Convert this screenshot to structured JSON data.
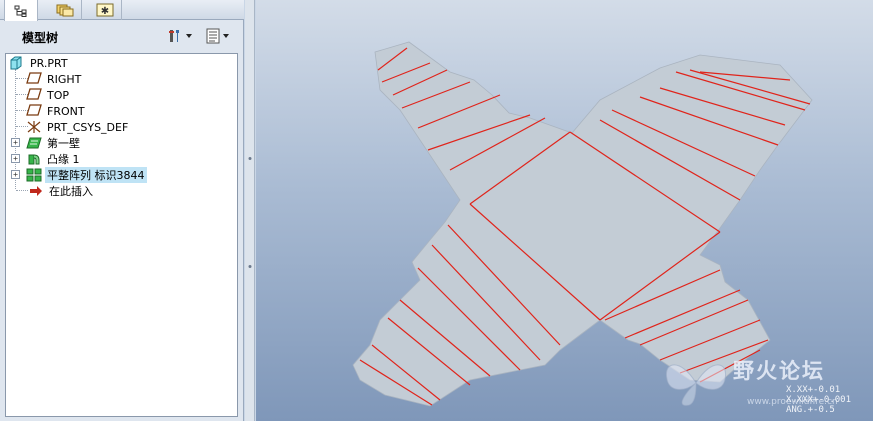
{
  "panel_tabs": [
    {
      "icon": "model-tree-icon",
      "active": true
    },
    {
      "icon": "folder-browser-icon",
      "active": false
    },
    {
      "icon": "favorites-icon",
      "active": false
    }
  ],
  "tree_header": {
    "title": "模型树",
    "settings_icon": "tools-icon",
    "show_icon": "list-icon"
  },
  "tree": {
    "items": [
      {
        "label": "PR.PRT",
        "icon": "part-icon"
      },
      {
        "label": "RIGHT",
        "icon": "datum-plane-icon"
      },
      {
        "label": "TOP",
        "icon": "datum-plane-icon"
      },
      {
        "label": "FRONT",
        "icon": "datum-plane-icon"
      },
      {
        "label": "PRT_CSYS_DEF",
        "icon": "csys-icon"
      },
      {
        "label": "第一壁",
        "icon": "first-wall-icon"
      },
      {
        "label": "凸缘 1",
        "icon": "flange-icon"
      },
      {
        "label": "平整阵列 标识3844",
        "icon": "pattern-icon"
      },
      {
        "label": "在此插入",
        "icon": "insert-here-arrow-icon"
      }
    ]
  },
  "viewport": {
    "tolerance_lines": [
      "X.XX+-0.01",
      "X.XXX+-0.001",
      "ANG.+-0.5"
    ],
    "watermark_text": "野火论坛",
    "watermark_url": "www.proewildfire.cn",
    "colors": {
      "sheet_fill": "#c3ccd5",
      "bend_line": "#e0241b"
    }
  }
}
